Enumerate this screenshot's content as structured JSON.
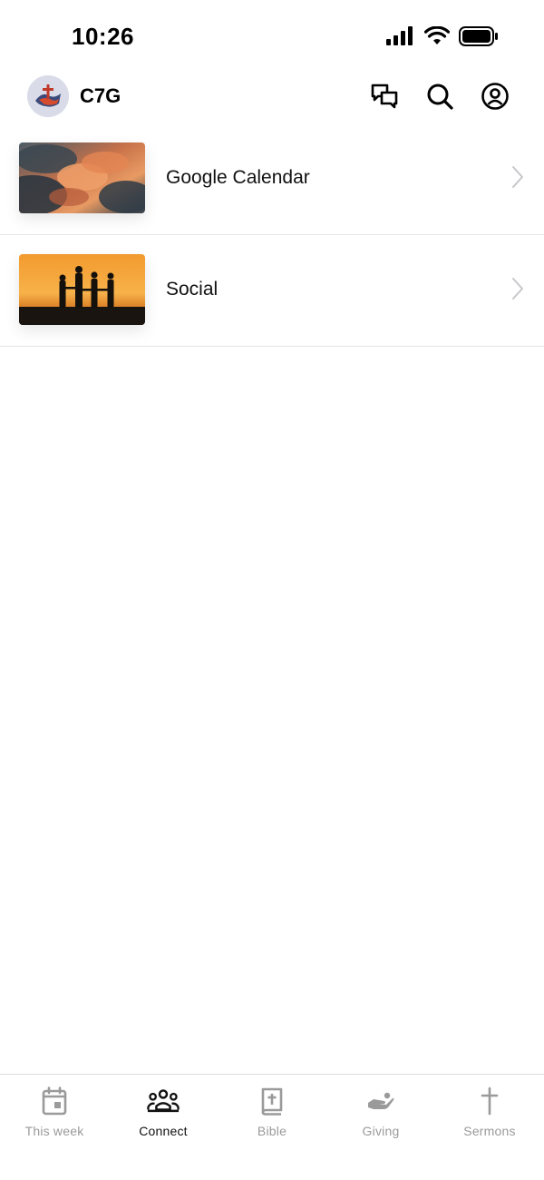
{
  "status_bar": {
    "time": "10:26"
  },
  "header": {
    "title": "C7G",
    "avatar_icon": "church-logo-icon",
    "actions": [
      {
        "name": "messages",
        "icon": "chat-bubbles-icon"
      },
      {
        "name": "search",
        "icon": "search-icon"
      },
      {
        "name": "profile",
        "icon": "account-circle-icon"
      }
    ]
  },
  "list": {
    "items": [
      {
        "label": "Google Calendar",
        "thumbnail": "sunset-clouds-image"
      },
      {
        "label": "Social",
        "thumbnail": "people-silhouette-sunset-image"
      }
    ]
  },
  "tabbar": {
    "active": "Connect",
    "colors": {
      "active": "#111111",
      "inactive": "#9a9a9a"
    },
    "tabs": [
      {
        "label": "This week",
        "icon": "calendar-icon"
      },
      {
        "label": "Connect",
        "icon": "people-group-icon"
      },
      {
        "label": "Bible",
        "icon": "bible-book-icon"
      },
      {
        "label": "Giving",
        "icon": "giving-hand-icon"
      },
      {
        "label": "Sermons",
        "icon": "cross-icon"
      }
    ]
  }
}
